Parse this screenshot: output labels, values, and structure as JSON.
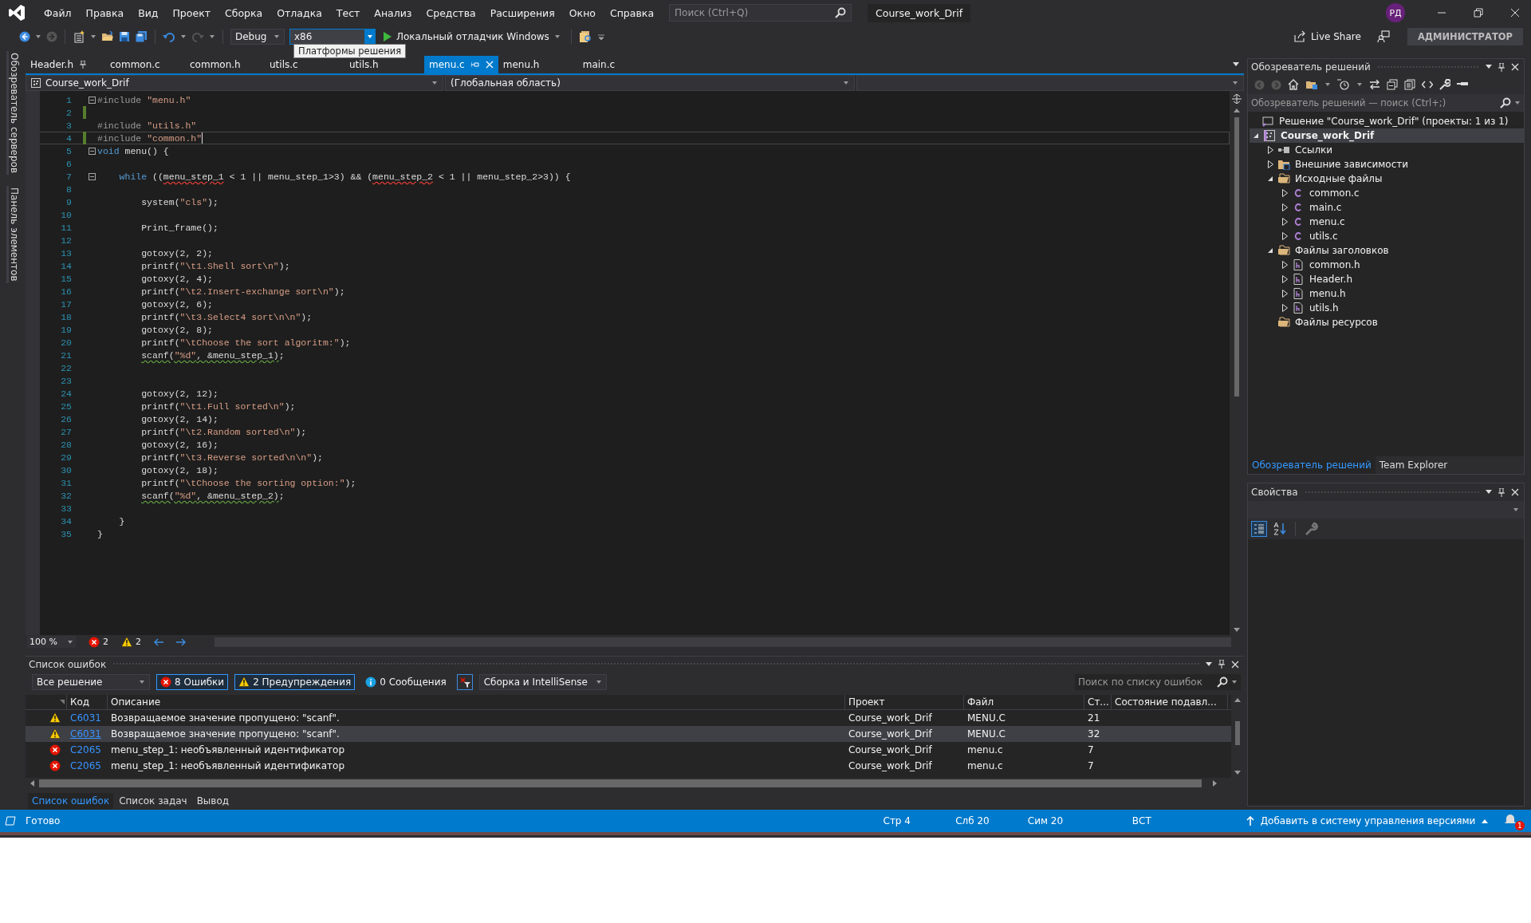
{
  "menu_bar": {
    "items": [
      "Файл",
      "Правка",
      "Вид",
      "Проект",
      "Сборка",
      "Отладка",
      "Тест",
      "Анализ",
      "Средства",
      "Расширения",
      "Окно",
      "Справка"
    ],
    "search": {
      "placeholder": "Поиск (Ctrl+Q)"
    },
    "solution_name": "Course_work_Drif",
    "avatar": "РД"
  },
  "toolbar": {
    "configuration": "Debug",
    "platform": "x86",
    "run_label": "Локальный отладчик Windows",
    "tooltip": "Платформы решения",
    "live_share": "Live Share",
    "account": "АДМИНИСТРАТОР"
  },
  "side_tabs": [
    "Обозреватель серверов",
    "Панель элементов"
  ],
  "document_tabs": [
    {
      "label": "Header.h",
      "selected": false,
      "pinned": true
    },
    {
      "label": "common.c",
      "selected": false,
      "pinned": false
    },
    {
      "label": "common.h",
      "selected": false,
      "pinned": false
    },
    {
      "label": "utils.c",
      "selected": false,
      "pinned": false
    },
    {
      "label": "utils.h",
      "selected": false,
      "pinned": false
    },
    {
      "label": "menu.c",
      "selected": true,
      "pinned": false
    },
    {
      "label": "menu.h",
      "selected": false,
      "pinned": false
    },
    {
      "label": "main.c",
      "selected": false,
      "pinned": false
    }
  ],
  "navigation_bar": {
    "project": "Course_work_Drif",
    "scope": "(Глобальная область)"
  },
  "editor": {
    "zoom": "100 %",
    "error_count": "2",
    "warning_count": "2",
    "lines": [
      {
        "number": "1",
        "fold": true,
        "changed": false,
        "current": false,
        "tokens": [
          {
            "kind": "preproc",
            "text": "#include "
          },
          {
            "kind": "string",
            "text": "\"menu.h\""
          }
        ]
      },
      {
        "number": "2",
        "fold": false,
        "changed": true,
        "current": false
      },
      {
        "number": "3",
        "fold": false,
        "changed": false,
        "current": false,
        "tokens": [
          {
            "kind": "preproc",
            "text": "#include "
          },
          {
            "kind": "string",
            "text": "\"utils.h\""
          }
        ]
      },
      {
        "number": "4",
        "fold": false,
        "changed": true,
        "current": true,
        "tokens": [
          {
            "kind": "preproc",
            "text": "#include "
          },
          {
            "kind": "string",
            "text": "\"common.h\""
          }
        ]
      },
      {
        "number": "5",
        "fold": true,
        "changed": false,
        "current": false,
        "tokens": [
          {
            "kind": "keyword",
            "text": "void"
          },
          {
            "kind": "plain",
            "text": " menu() {"
          }
        ]
      },
      {
        "number": "6",
        "fold": false,
        "changed": false,
        "current": false
      },
      {
        "number": "7",
        "fold": true,
        "changed": false,
        "current": false,
        "tokens": [
          {
            "kind": "keyword",
            "text": "    while"
          },
          {
            "kind": "plain",
            "text": " (("
          },
          {
            "kind": "error",
            "text": "menu_step_1"
          },
          {
            "kind": "plain",
            "text": " < 1 || menu_step_1>3) && ("
          },
          {
            "kind": "error",
            "text": "menu_step_2"
          },
          {
            "kind": "plain",
            "text": " < 1 || menu_step_2>3)) {"
          }
        ]
      },
      {
        "number": "8",
        "fold": false,
        "changed": false,
        "current": false
      },
      {
        "number": "9",
        "fold": false,
        "changed": false,
        "current": false,
        "tokens": [
          {
            "kind": "plain",
            "text": "        system("
          },
          {
            "kind": "string",
            "text": "\"cls\""
          },
          {
            "kind": "plain",
            "text": ");"
          }
        ]
      },
      {
        "number": "10",
        "fold": false,
        "changed": false,
        "current": false
      },
      {
        "number": "11",
        "fold": false,
        "changed": false,
        "current": false,
        "tokens": [
          {
            "kind": "plain",
            "text": "        Print_frame();"
          }
        ]
      },
      {
        "number": "12",
        "fold": false,
        "changed": false,
        "current": false
      },
      {
        "number": "13",
        "fold": false,
        "changed": false,
        "current": false,
        "tokens": [
          {
            "kind": "plain",
            "text": "        gotoxy(2, 2);"
          }
        ]
      },
      {
        "number": "14",
        "fold": false,
        "changed": false,
        "current": false,
        "tokens": [
          {
            "kind": "plain",
            "text": "        printf("
          },
          {
            "kind": "string",
            "text": "\"\\t1.Shell sort\\n\""
          },
          {
            "kind": "plain",
            "text": ");"
          }
        ]
      },
      {
        "number": "15",
        "fold": false,
        "changed": false,
        "current": false,
        "tokens": [
          {
            "kind": "plain",
            "text": "        gotoxy(2, 4);"
          }
        ]
      },
      {
        "number": "16",
        "fold": false,
        "changed": false,
        "current": false,
        "tokens": [
          {
            "kind": "plain",
            "text": "        printf("
          },
          {
            "kind": "string",
            "text": "\"\\t2.Insert-exchange sort\\n\""
          },
          {
            "kind": "plain",
            "text": ");"
          }
        ]
      },
      {
        "number": "17",
        "fold": false,
        "changed": false,
        "current": false,
        "tokens": [
          {
            "kind": "plain",
            "text": "        gotoxy(2, 6);"
          }
        ]
      },
      {
        "number": "18",
        "fold": false,
        "changed": false,
        "current": false,
        "tokens": [
          {
            "kind": "plain",
            "text": "        printf("
          },
          {
            "kind": "string",
            "text": "\"\\t3.Select4 sort\\n\\n\""
          },
          {
            "kind": "plain",
            "text": ");"
          }
        ]
      },
      {
        "number": "19",
        "fold": false,
        "changed": false,
        "current": false,
        "tokens": [
          {
            "kind": "plain",
            "text": "        gotoxy(2, 8);"
          }
        ]
      },
      {
        "number": "20",
        "fold": false,
        "changed": false,
        "current": false,
        "tokens": [
          {
            "kind": "plain",
            "text": "        printf("
          },
          {
            "kind": "string",
            "text": "\"\\tChoose the sort algoritm:\""
          },
          {
            "kind": "plain",
            "text": ");"
          }
        ]
      },
      {
        "number": "21",
        "fold": false,
        "changed": false,
        "current": false,
        "tokens": [
          {
            "kind": "warning",
            "text": "        scanf("
          },
          {
            "kind": "warning_string",
            "text": "\"%d\""
          },
          {
            "kind": "warning",
            "text": ", &menu_step_1)"
          },
          {
            "kind": "plain",
            "text": ";"
          }
        ]
      },
      {
        "number": "22",
        "fold": false,
        "changed": false,
        "current": false
      },
      {
        "number": "23",
        "fold": false,
        "changed": false,
        "current": false
      },
      {
        "number": "24",
        "fold": false,
        "changed": false,
        "current": false,
        "tokens": [
          {
            "kind": "plain",
            "text": "        gotoxy(2, 12);"
          }
        ]
      },
      {
        "number": "25",
        "fold": false,
        "changed": false,
        "current": false,
        "tokens": [
          {
            "kind": "plain",
            "text": "        printf("
          },
          {
            "kind": "string",
            "text": "\"\\t1.Full sorted\\n\""
          },
          {
            "kind": "plain",
            "text": ");"
          }
        ]
      },
      {
        "number": "26",
        "fold": false,
        "changed": false,
        "current": false,
        "tokens": [
          {
            "kind": "plain",
            "text": "        gotoxy(2, 14);"
          }
        ]
      },
      {
        "number": "27",
        "fold": false,
        "changed": false,
        "current": false,
        "tokens": [
          {
            "kind": "plain",
            "text": "        printf("
          },
          {
            "kind": "string",
            "text": "\"\\t2.Random sorted\\n\""
          },
          {
            "kind": "plain",
            "text": ");"
          }
        ]
      },
      {
        "number": "28",
        "fold": false,
        "changed": false,
        "current": false,
        "tokens": [
          {
            "kind": "plain",
            "text": "        gotoxy(2, 16);"
          }
        ]
      },
      {
        "number": "29",
        "fold": false,
        "changed": false,
        "current": false,
        "tokens": [
          {
            "kind": "plain",
            "text": "        printf("
          },
          {
            "kind": "string",
            "text": "\"\\t3.Reverse sorted\\n\\n\""
          },
          {
            "kind": "plain",
            "text": ");"
          }
        ]
      },
      {
        "number": "30",
        "fold": false,
        "changed": false,
        "current": false,
        "tokens": [
          {
            "kind": "plain",
            "text": "        gotoxy(2, 18);"
          }
        ]
      },
      {
        "number": "31",
        "fold": false,
        "changed": false,
        "current": false,
        "tokens": [
          {
            "kind": "plain",
            "text": "        printf("
          },
          {
            "kind": "string",
            "text": "\"\\tChoose the sorting option:\""
          },
          {
            "kind": "plain",
            "text": ");"
          }
        ]
      },
      {
        "number": "32",
        "fold": false,
        "changed": false,
        "current": false,
        "tokens": [
          {
            "kind": "warning",
            "text": "        scanf("
          },
          {
            "kind": "warning_string",
            "text": "\"%d\""
          },
          {
            "kind": "warning",
            "text": ", &menu_step_2)"
          },
          {
            "kind": "plain",
            "text": ";"
          }
        ]
      },
      {
        "number": "33",
        "fold": false,
        "changed": false,
        "current": false
      },
      {
        "number": "34",
        "fold": false,
        "changed": false,
        "current": false,
        "tokens": [
          {
            "kind": "plain",
            "text": "    }"
          }
        ]
      },
      {
        "number": "35",
        "fold": false,
        "changed": false,
        "current": false,
        "tokens": [
          {
            "kind": "plain",
            "text": "}"
          }
        ]
      }
    ]
  },
  "error_list": {
    "title": "Список ошибок",
    "scope": "Все решение",
    "filters": [
      {
        "kind": "error",
        "label": "8 Ошибки",
        "selected": true
      },
      {
        "kind": "warning",
        "label": "2 Предупреждения",
        "selected": true
      },
      {
        "kind": "info",
        "label": "0 Сообщения",
        "selected": false
      }
    ],
    "source": "Сборка и IntelliSense",
    "search": {
      "placeholder": "Поиск по списку ошибок"
    },
    "columns": [
      "Код",
      "Описание",
      "Проект",
      "Файл",
      "Ст...",
      "Состояние подавл..."
    ],
    "rows": [
      {
        "kind": "warning",
        "code": "C6031",
        "description": "Возвращаемое значение пропущено: \"scanf\".",
        "project": "Course_work_Drif",
        "file": "MENU.C",
        "line": "21",
        "selected": false
      },
      {
        "kind": "warning",
        "code": "C6031",
        "description": "Возвращаемое значение пропущено: \"scanf\".",
        "project": "Course_work_Drif",
        "file": "MENU.C",
        "line": "32",
        "selected": true
      },
      {
        "kind": "error",
        "code": "C2065",
        "description": "menu_step_1: необъявленный идентификатор",
        "project": "Course_work_Drif",
        "file": "menu.c",
        "line": "7",
        "selected": false
      },
      {
        "kind": "error",
        "code": "C2065",
        "description": "menu_step_1: необъявленный идентификатор",
        "project": "Course_work_Drif",
        "file": "menu.c",
        "line": "7",
        "selected": false
      }
    ],
    "tabs": [
      {
        "label": "Список ошибок",
        "selected": true
      },
      {
        "label": "Список задач",
        "selected": false
      },
      {
        "label": "Вывод",
        "selected": false
      }
    ]
  },
  "solution_explorer": {
    "title": "Обозреватель решений",
    "search": {
      "placeholder": "Обозреватель решений — поиск (Ctrl+;)"
    },
    "tree": [
      {
        "label": "Решение \"Course_work_Drif\" (проекты: 1 из 1)",
        "kind": "solution",
        "selected": false,
        "children": [
          {
            "label": "Course_work_Drif",
            "kind": "project",
            "expanded": true,
            "selected": true,
            "children": [
              {
                "label": "Ссылки",
                "kind": "references",
                "expanded": false,
                "selected": false
              },
              {
                "label": "Внешние зависимости",
                "kind": "external",
                "expanded": false,
                "selected": false
              },
              {
                "label": "Исходные файлы",
                "kind": "folder",
                "expanded": true,
                "selected": false,
                "children": [
                  {
                    "label": "common.c",
                    "kind": "c_file",
                    "expanded": false,
                    "selected": false
                  },
                  {
                    "label": "main.c",
                    "kind": "c_file",
                    "expanded": false,
                    "selected": false
                  },
                  {
                    "label": "menu.c",
                    "kind": "c_file",
                    "expanded": false,
                    "selected": false
                  },
                  {
                    "label": "utils.c",
                    "kind": "c_file",
                    "expanded": false,
                    "selected": false
                  }
                ]
              },
              {
                "label": "Файлы заголовков",
                "kind": "folder",
                "expanded": true,
                "selected": false,
                "children": [
                  {
                    "label": "common.h",
                    "kind": "h_file",
                    "expanded": false,
                    "selected": false
                  },
                  {
                    "label": "Header.h",
                    "kind": "h_file",
                    "expanded": false,
                    "selected": false
                  },
                  {
                    "label": "menu.h",
                    "kind": "h_file",
                    "expanded": false,
                    "selected": false
                  },
                  {
                    "label": "utils.h",
                    "kind": "h_file",
                    "expanded": false,
                    "selected": false
                  }
                ]
              },
              {
                "label": "Файлы ресурсов",
                "kind": "folder",
                "selected": false
              }
            ]
          }
        ]
      }
    ],
    "tabs": [
      {
        "label": "Обозреватель решений",
        "selected": true
      },
      {
        "label": "Team Explorer",
        "selected": false
      }
    ]
  },
  "properties": {
    "title": "Свойства"
  },
  "status_bar": {
    "message": "Готово",
    "line": "Стр 4",
    "column": "Слб 20",
    "char": "Сим 20",
    "mode": "ВСТ",
    "source_control": "Добавить в систему управления версиями",
    "notifications": "1"
  }
}
